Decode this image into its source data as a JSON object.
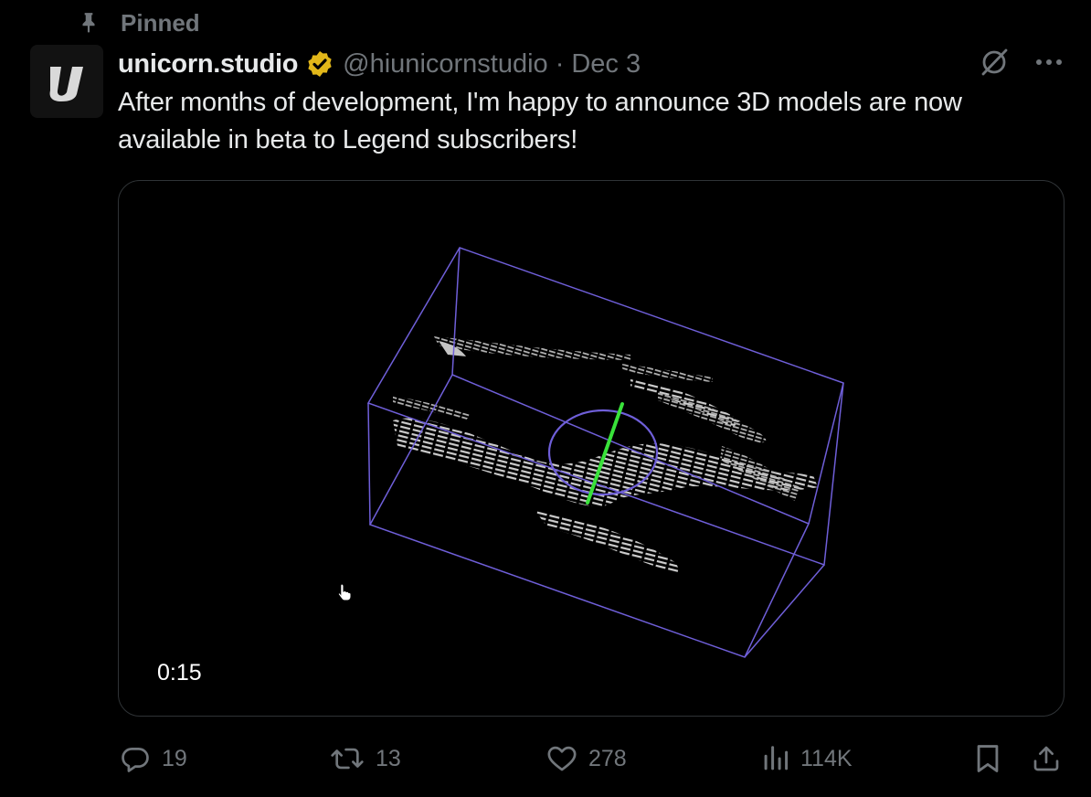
{
  "pinned_label": "Pinned",
  "author": {
    "display_name": "unicorn.studio",
    "handle": "@hiunicornstudio",
    "separator": "·",
    "date": "Dec 3",
    "verified_color": "#e2b719"
  },
  "text": {
    "line1": "After months of development, I'm happy to announce 3D models are now",
    "line2": "available in beta to Legend subscribers!"
  },
  "media": {
    "type": "video",
    "timestamp": "0:15",
    "wireframe_color": "#6f5fd9",
    "axis_color": "#39e23a"
  },
  "actions": {
    "replies": "19",
    "reposts": "13",
    "likes": "278",
    "views": "114K"
  },
  "icons": {
    "pin": "pin-icon",
    "verified": "verified-badge-icon",
    "grok": "grok-icon",
    "more": "more-icon",
    "reply": "reply-icon",
    "repost": "repost-icon",
    "like": "heart-icon",
    "views": "views-icon",
    "bookmark": "bookmark-icon",
    "share": "share-icon"
  }
}
